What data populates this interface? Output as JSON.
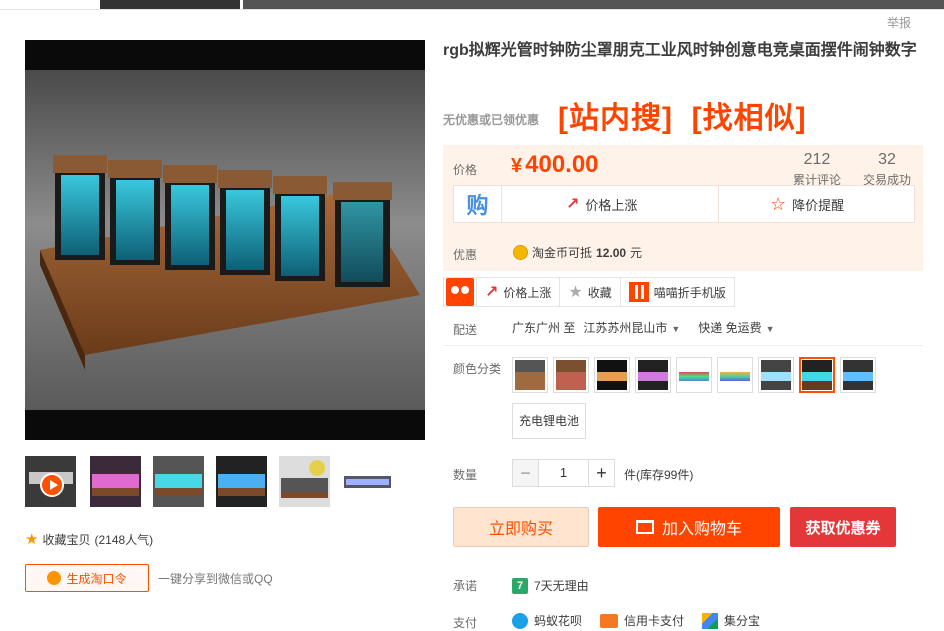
{
  "report": "举报",
  "product": {
    "title": "rgb拟辉光管时钟防尘罩朋克工业风时钟创意电竞桌面摆件闹钟数字",
    "no_discount": "无优惠或已领优惠",
    "search_inside": "[站内搜]",
    "find_similar": "[找相似]"
  },
  "price": {
    "label": "价格",
    "currency": "¥",
    "value": "400.00",
    "reviews_count": "212",
    "reviews_label": "累计评论",
    "sales_count": "32",
    "sales_label": "交易成功",
    "gou": "购",
    "price_up": "价格上涨",
    "price_alert": "降价提醒",
    "promo_label": "优惠",
    "promo_text": "淘金币可抵",
    "promo_amount": "12.00",
    "promo_unit": "元"
  },
  "actions": {
    "price_up": "价格上涨",
    "favorite": "收藏",
    "mobile": "喵喵折手机版"
  },
  "shipping": {
    "label": "配送",
    "from": "广东广州 至",
    "to": "江苏苏州昆山市",
    "method": "快递 免运费"
  },
  "options": {
    "label": "颜色分类",
    "text_option": "充电锂电池"
  },
  "quantity": {
    "label": "数量",
    "value": "1",
    "stock": "件(库存99件)"
  },
  "buttons": {
    "buy": "立即购买",
    "cart": "加入购物车",
    "coupon": "获取优惠券"
  },
  "promise": {
    "label": "承诺",
    "seven": "7",
    "text": "7天无理由"
  },
  "payment": {
    "label": "支付",
    "huabei": "蚂蚁花呗",
    "card": "信用卡支付",
    "jfb": "集分宝"
  },
  "left": {
    "favorite": "收藏宝贝",
    "popularity": "(2148人气)",
    "gen_button": "生成淘口令",
    "share": "一键分享到微信或QQ"
  },
  "colors": {
    "accent": "#ff5000",
    "price": "#ff4400",
    "coupon": "#e5363a"
  }
}
